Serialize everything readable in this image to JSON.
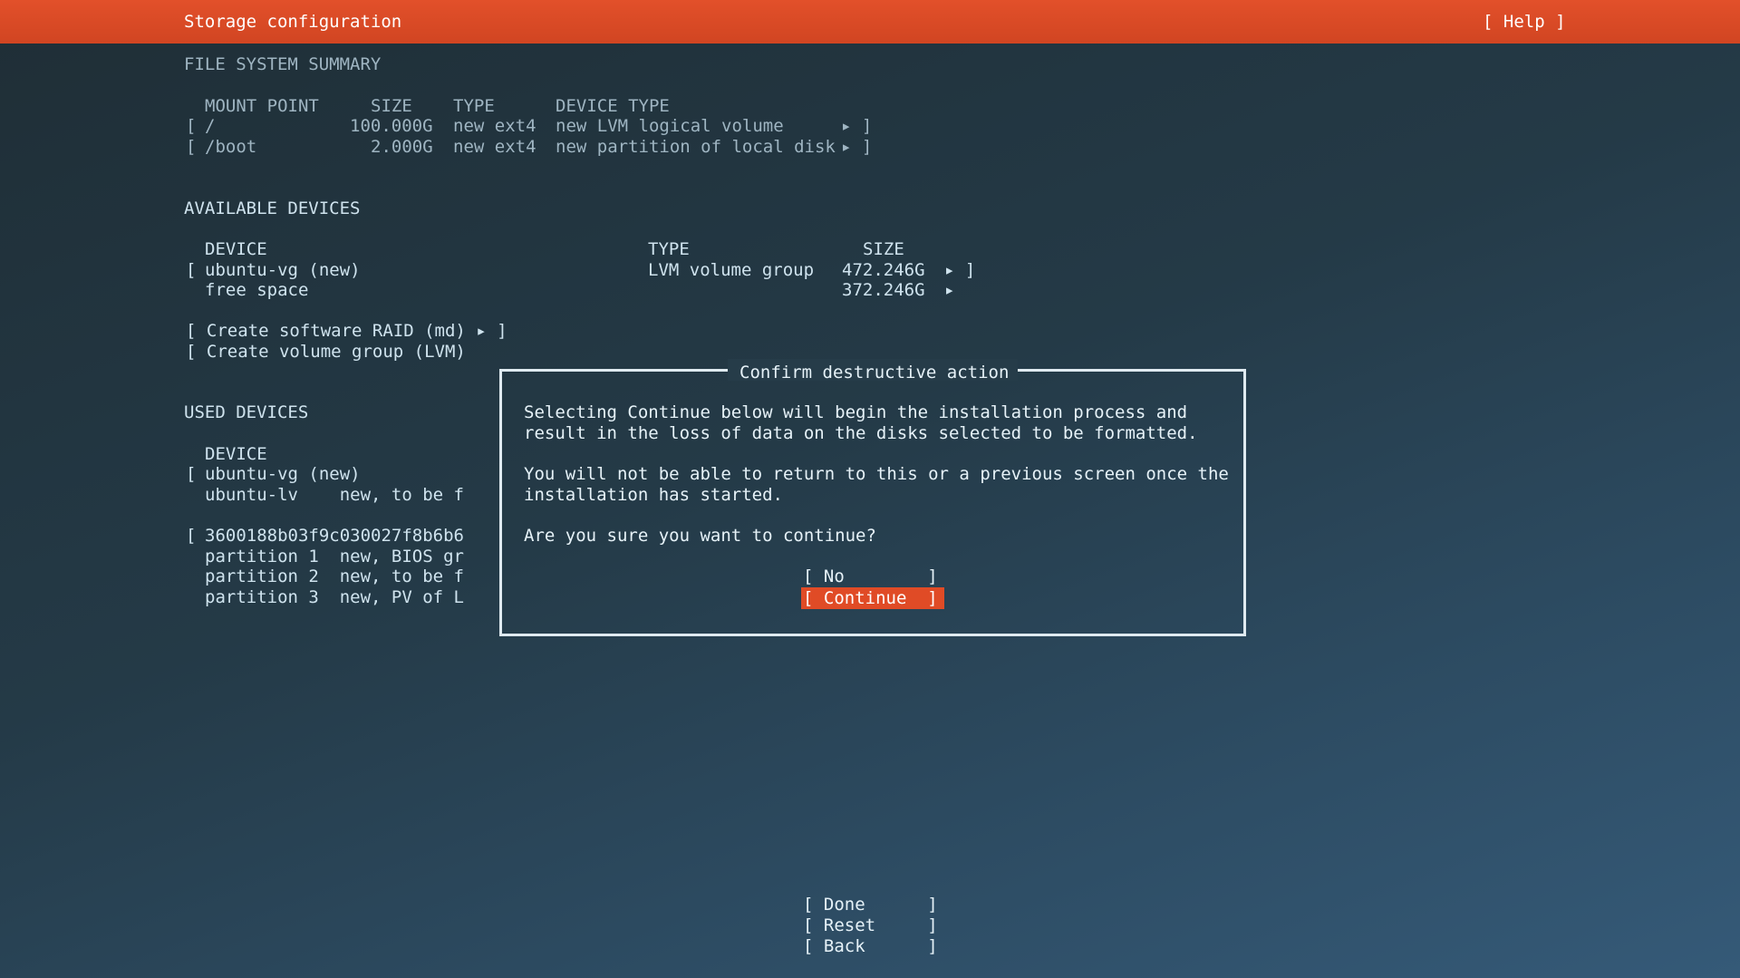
{
  "header": {
    "title": "Storage configuration",
    "help": "[ Help ]"
  },
  "fs_summary": {
    "heading": "FILE SYSTEM SUMMARY",
    "columns": [
      "MOUNT POINT",
      "SIZE",
      "TYPE",
      "DEVICE TYPE"
    ],
    "rows": [
      {
        "bracket_open": "[",
        "mount": "/",
        "size": "100.000G",
        "type": "new ext4",
        "device_type": "new LVM logical volume",
        "arrow": "▸ ]"
      },
      {
        "bracket_open": "[",
        "mount": "/boot",
        "size": "2.000G",
        "type": "new ext4",
        "device_type": "new partition of local disk",
        "arrow": "▸ ]"
      }
    ]
  },
  "available": {
    "heading": "AVAILABLE DEVICES",
    "columns": [
      "DEVICE",
      "TYPE",
      "SIZE"
    ],
    "rows": [
      {
        "bracket_open": "[",
        "device": "ubuntu-vg (new)",
        "type": "LVM volume group",
        "size": "472.246G",
        "arrow": "▸ ]"
      },
      {
        "bracket_open": "",
        "device": "free space",
        "type": "",
        "size": "372.246G",
        "arrow": "▸"
      }
    ],
    "actions": [
      "[ Create software RAID (md) ▸ ]",
      "[ Create volume group (LVM)"
    ]
  },
  "used": {
    "heading": "USED DEVICES",
    "column": "DEVICE",
    "lines": [
      {
        "bracket": "[",
        "text": "ubuntu-vg (new)"
      },
      {
        "bracket": "",
        "text": "ubuntu-lv    new, to be f"
      },
      {
        "bracket": "[",
        "text": "3600188b03f9c030027f8b6b6"
      },
      {
        "bracket": "",
        "text": "partition 1  new, BIOS gr"
      },
      {
        "bracket": "",
        "text": "partition 2  new, to be f"
      },
      {
        "bracket": "",
        "text": "partition 3  new, PV of L"
      }
    ]
  },
  "dialog": {
    "title": "Confirm destructive action",
    "para1_line1": "Selecting Continue below will begin the installation process and",
    "para1_line2": "result in the loss of data on the disks selected to be formatted.",
    "para2_line1": "You will not be able to return to this or a previous screen once the",
    "para2_line2": "installation has started.",
    "question": "Are you sure you want to continue?",
    "btn_no": "[ No        ]",
    "btn_continue": "[ Continue  ]"
  },
  "footer": {
    "done": "[ Done      ]",
    "reset": "[ Reset     ]",
    "back": "[ Back      ]"
  },
  "colors": {
    "header_bg": "#d14522",
    "focus_bg": "#e04b26",
    "background": "#243a47",
    "text": "#cfe3ee"
  }
}
